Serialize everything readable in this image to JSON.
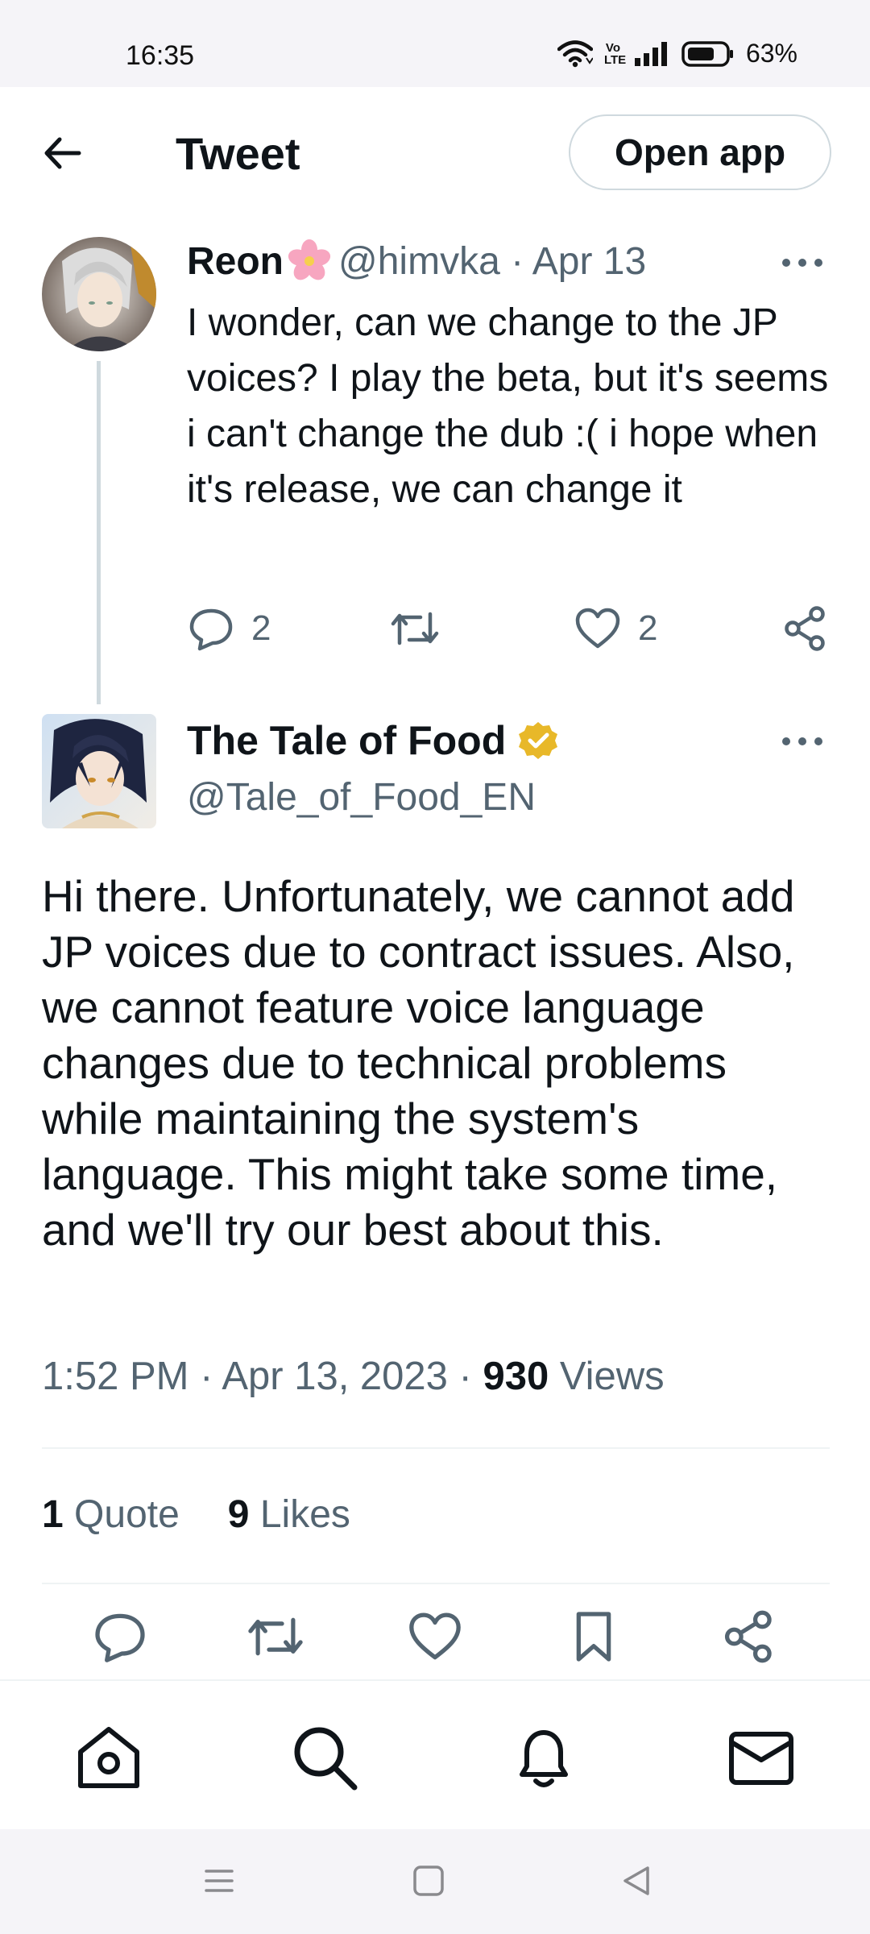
{
  "status_bar": {
    "time": "16:35",
    "volte": "Vo LTE",
    "battery": "63%",
    "icons": [
      "wifi-icon",
      "volte-icon",
      "signal-icon",
      "battery-icon"
    ]
  },
  "header": {
    "title": "Tweet",
    "open_app_label": "Open app"
  },
  "parent_tweet": {
    "name": "Reon",
    "name_emoji": "🌸",
    "meta": "@himvka · Apr 13",
    "text": "I wonder, can we change to the JP voices? I play the beta, but it's seems i can't change the dub :( i hope when it's release, we can change it",
    "reply_count": "2",
    "like_count": "2"
  },
  "main_tweet": {
    "name": "The Tale of Food",
    "handle": "@Tale_of_Food_EN",
    "text": "Hi there. Unfortunately, we cannot add JP voices due to contract issues. Also, we cannot feature voice language changes due to technical problems while maintaining the system's language. This might take some time, and we'll try our best about this.",
    "timestamp": "1:52 PM · Apr 13, 2023 · ",
    "views_count": "930",
    "views_label": " Views",
    "quote_count": "1",
    "quote_label": " Quote",
    "likes_count": "9",
    "likes_label": " Likes"
  },
  "bottom_nav": [
    "home-icon",
    "search-icon",
    "notifications-icon",
    "messages-icon"
  ],
  "colors": {
    "text": "#0f1419",
    "secondary": "#536471",
    "border": "#cfd9de",
    "verified_gold": "#e8b829"
  }
}
